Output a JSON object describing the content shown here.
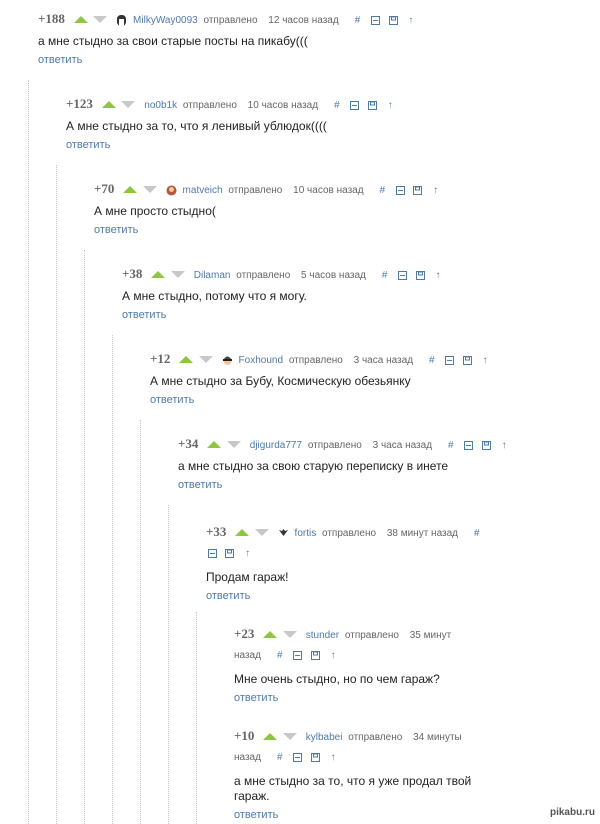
{
  "reply_label": "ответить",
  "sent_label": "отправлено",
  "tool_glyphs": {
    "hash": "#",
    "up_arrow": "↑"
  },
  "comments": [
    {
      "score": "+188",
      "username": "MilkyWay0093",
      "time": "12 часов назад",
      "text": "а мне стыдно за свои старые посты на пикабу(((",
      "avatar": "avatar-icon"
    },
    {
      "score": "+123",
      "username": "no0b1k",
      "time": "10 часов назад",
      "text": "А мне стыдно за то, что я ленивый ублюдок((((",
      "avatar": ""
    },
    {
      "score": "+70",
      "username": "matveich",
      "time": "10 часов назад",
      "text": "А мне просто стыдно(",
      "avatar": "avatar-icon"
    },
    {
      "score": "+38",
      "username": "Dilaman",
      "time": "5 часов назад",
      "text": "А мне стыдно, потому что я могу.",
      "avatar": ""
    },
    {
      "score": "+12",
      "username": "Foxhound",
      "time": "3 часа назад",
      "text": "А мне стыдно за Бубу, Космическую обезьянку",
      "avatar": "avatar-icon"
    },
    {
      "score": "+34",
      "username": "djigurda777",
      "time": "3 часа назад",
      "text": "а мне стыдно за свою старую переписку в инете",
      "avatar": ""
    },
    {
      "score": "+33",
      "username": "fortis",
      "time": "38 минут назад",
      "text": "Продам гараж!",
      "avatar": "avatar-icon"
    },
    {
      "score": "+23",
      "username": "stunder",
      "time": "35 минут назад",
      "text": "Мне очень стыдно, но по чем гараж?",
      "avatar": ""
    },
    {
      "score": "+10",
      "username": "kylbabei",
      "time": "34 минуты назад",
      "text": "а мне стыдно за то, что я уже продал твой гараж.",
      "avatar": ""
    }
  ],
  "watermark": "pikabu.ru",
  "colors": {
    "vote_up": "#8dc63f",
    "vote_down": "#c8c8c8",
    "link": "#4e7aa8"
  }
}
